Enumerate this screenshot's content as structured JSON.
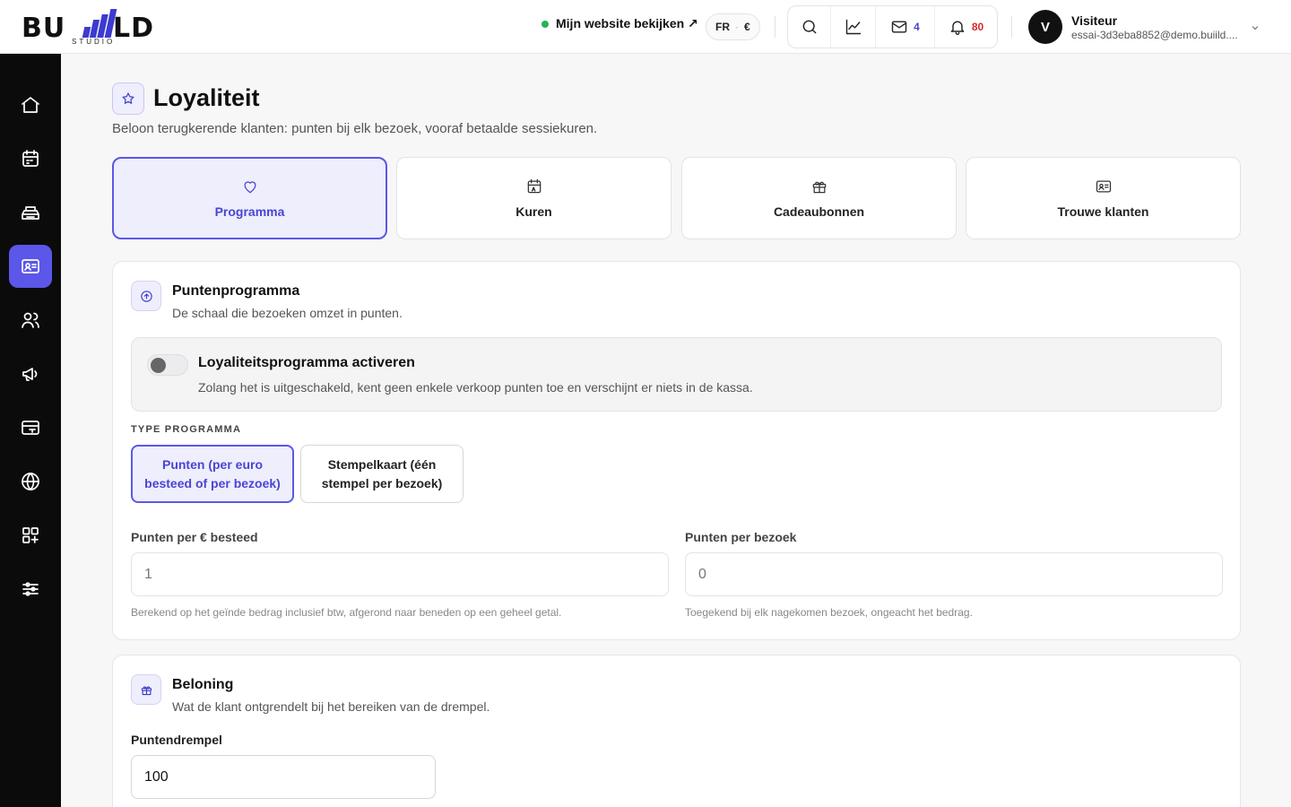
{
  "brand": {
    "logo_left": "BU",
    "logo_right": "LD",
    "logo_sub": "STUDIO"
  },
  "header": {
    "site_link": "Mijn website bekijken ↗",
    "lang": "FR",
    "currency": "€",
    "messages_count": "4",
    "notifications_count": "80",
    "user": {
      "initial": "V",
      "name": "Visiteur",
      "email": "essai-3d3eba8852@demo.buiild...."
    }
  },
  "sidebar": {
    "items": [
      {
        "icon": "home-icon",
        "active": false
      },
      {
        "icon": "calendar-icon",
        "active": false
      },
      {
        "icon": "cash-register-icon",
        "active": false
      },
      {
        "icon": "id-card-icon",
        "active": true
      },
      {
        "icon": "users-icon",
        "active": false
      },
      {
        "icon": "megaphone-icon",
        "active": false
      },
      {
        "icon": "credit-card-icon",
        "active": false
      },
      {
        "icon": "globe-icon",
        "active": false
      },
      {
        "icon": "apps-add-icon",
        "active": false
      },
      {
        "icon": "sliders-icon",
        "active": false
      }
    ]
  },
  "page": {
    "title": "Loyaliteit",
    "subtitle": "Beloon terugkerende klanten: punten bij elk bezoek, vooraf betaalde sessiekuren."
  },
  "tabs": [
    {
      "label": "Programma",
      "icon": "heart-icon",
      "active": true
    },
    {
      "label": "Kuren",
      "icon": "calendar-icon",
      "active": false
    },
    {
      "label": "Cadeaubonnen",
      "icon": "gift-icon",
      "active": false
    },
    {
      "label": "Trouwe klanten",
      "icon": "id-card-icon",
      "active": false
    }
  ],
  "points_card": {
    "title": "Puntenprogramma",
    "subtitle": "De schaal die bezoeken omzet in punten.",
    "toggle": {
      "title": "Loyaliteitsprogramma activeren",
      "description": "Zolang het is uitgeschakeld, kent geen enkele verkoop punten toe en verschijnt er niets in de kassa.",
      "enabled": false
    },
    "type_label": "TYPE PROGRAMMA",
    "types": [
      {
        "label": "Punten (per euro besteed of per bezoek)",
        "active": true
      },
      {
        "label": "Stempelkaart (één stempel per bezoek)",
        "active": false
      }
    ],
    "per_euro": {
      "label": "Punten per € besteed",
      "value": "1",
      "hint": "Berekend op het geïnde bedrag inclusief btw, afgerond naar beneden op een geheel getal."
    },
    "per_visit": {
      "label": "Punten per bezoek",
      "value": "0",
      "hint": "Toegekend bij elk nagekomen bezoek, ongeacht het bedrag."
    }
  },
  "reward_card": {
    "title": "Beloning",
    "subtitle": "Wat de klant ontgrendelt bij het bereiken van de drempel.",
    "threshold_label": "Puntendrempel",
    "threshold_value": "100"
  },
  "colors": {
    "accent": "#5b57e8",
    "accent_light": "#eeeefc",
    "sidebar_bg": "#0b0b0c",
    "online": "#22b455",
    "notif": "#d42b2b"
  }
}
